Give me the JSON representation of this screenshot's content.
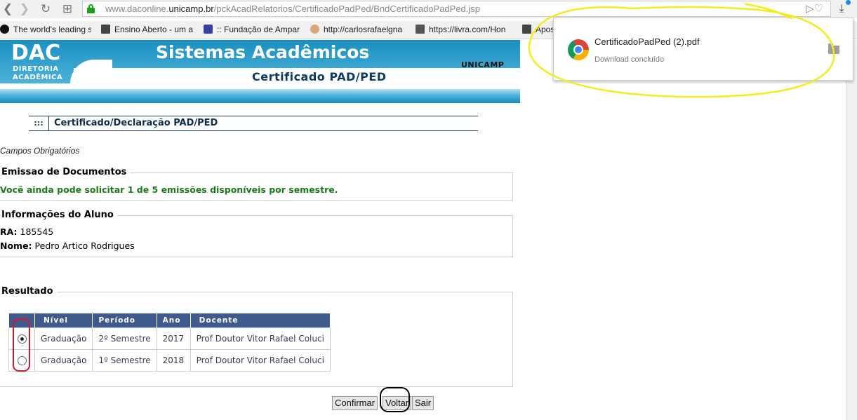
{
  "browser": {
    "url_prefix": "www.daconline.",
    "url_domain": "unicamp.br",
    "url_path": "/pckAcadRelatorios/CertificadoPadPed/BndCertificadoPadPed.jsp",
    "nav_back": "❮",
    "nav_forward": "❯",
    "nav_reload": "↻",
    "nav_apps": "⊞",
    "url_icons": "▷♡",
    "download_icon": "⤓",
    "bookmarks": [
      {
        "label": "The world's leading s"
      },
      {
        "label": "Ensino Aberto - um a"
      },
      {
        "label": ":: Fundação de Ampar"
      },
      {
        "label": "http://carlosrafaelgna"
      },
      {
        "label": "https://livra.com/Hon"
      },
      {
        "label": "Apos"
      }
    ]
  },
  "download_popup": {
    "filename": "CertificadoPadPed (2).pdf",
    "status": "Download concluído"
  },
  "header": {
    "logo": "DAC",
    "logo_line1": "DIRETORIA",
    "logo_line2": "ACADÊMICA",
    "system_title": "Sistemas Acadêmicos",
    "org": "UNICAMP",
    "page_title": "Certificado PAD/PED"
  },
  "section": {
    "dots": ":::",
    "title": "Certificado/Declaração PAD/PED"
  },
  "required_note": "Campos Obrigatórios",
  "emissao": {
    "legend": "Emissao de Documentos",
    "message": "Você ainda pode solicitar 1 de 5 emissões disponíveis por semestre."
  },
  "aluno": {
    "legend": "Informações do Aluno",
    "ra_label": "RA:",
    "ra_value": "185545",
    "nome_label": "Nome:",
    "nome_value": "Pedro Artico Rodrigues"
  },
  "resultado": {
    "legend": "Resultado",
    "columns": [
      "Nível",
      "Período",
      "Ano",
      "Docente"
    ],
    "rows": [
      {
        "selected": true,
        "nivel": "Graduação",
        "periodo": "2º Semestre",
        "ano": "2017",
        "docente": "Prof Doutor Vitor Rafael Coluci"
      },
      {
        "selected": false,
        "nivel": "Graduação",
        "periodo": "1º Semestre",
        "ano": "2018",
        "docente": "Prof Doutor Vitor Rafael Coluci"
      }
    ]
  },
  "buttons": {
    "confirmar": "Confirmar",
    "voltar": "Voltar",
    "sair": "Sair"
  },
  "colors": {
    "banner_blue": "#1a8fbf",
    "table_header": "#3f5a8d",
    "success_green": "#1a7a1a",
    "highlight_yellow": "#f5ec1c",
    "highlight_red": "#d11a2a"
  }
}
